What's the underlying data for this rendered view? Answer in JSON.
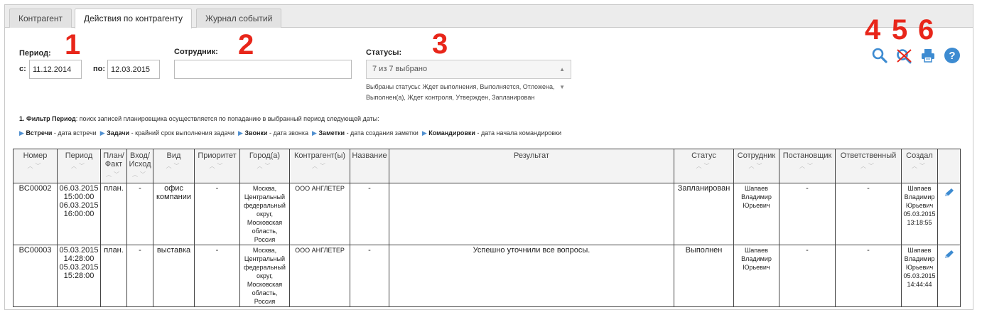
{
  "tabs": [
    {
      "label": "Контрагент"
    },
    {
      "label": "Действия по контрагенту"
    },
    {
      "label": "Журнал событий"
    }
  ],
  "filters": {
    "period_label": "Период:",
    "from_label": "с:",
    "from_value": "11.12.2014",
    "to_label": "по:",
    "to_value": "12.03.2015",
    "employee_label": "Сотрудник:",
    "employee_value": "",
    "statuses_label": "Статусы:",
    "statuses_value": "7 из 7 выбрано",
    "statuses_note_1": "Выбраны статусы: Ждет выполнения, Выполняется, Отложена,",
    "statuses_note_2": "Выполнен(а), Ждет контроля, Утвержден, Запланирован"
  },
  "markers": [
    "1",
    "2",
    "3",
    "4",
    "5",
    "6"
  ],
  "icons": {
    "search": "search-icon",
    "clear": "clear-filter-icon",
    "print": "print-icon",
    "help": "help-icon",
    "accent": "#3d8bd1",
    "marker_color": "#e8261a"
  },
  "note": {
    "intro_bold": "1. Фильтр Период",
    "intro_rest": ": поиск записей планировщика осуществляется по попаданию в выбранный период следующей даты:",
    "items": [
      {
        "bold": "Встречи",
        "rest": " - дата встречи"
      },
      {
        "bold": "Задачи",
        "rest": " - крайний срок выполнения задачи"
      },
      {
        "bold": "Звонки",
        "rest": " - дата звонка"
      },
      {
        "bold": "Заметки",
        "rest": " - дата создания заметки"
      },
      {
        "bold": "Командировки",
        "rest": " - дата начала командировки"
      }
    ]
  },
  "table": {
    "headers": [
      {
        "l1": "Номер",
        "l2": "",
        "sort": true
      },
      {
        "l1": "Период",
        "l2": "",
        "sort": true
      },
      {
        "l1": "План/",
        "l2": "Факт",
        "sort": true
      },
      {
        "l1": "Вход/",
        "l2": "Исход",
        "sort": true
      },
      {
        "l1": "Вид",
        "l2": "",
        "sort": true
      },
      {
        "l1": "Приоритет",
        "l2": "",
        "sort": true
      },
      {
        "l1": "Город(а)",
        "l2": "",
        "sort": true
      },
      {
        "l1": "Контрагент(ы)",
        "l2": "",
        "sort": true
      },
      {
        "l1": "Название",
        "l2": "",
        "sort": false
      },
      {
        "l1": "Результат",
        "l2": "",
        "sort": false
      },
      {
        "l1": "Статус",
        "l2": "",
        "sort": true
      },
      {
        "l1": "Сотрудник",
        "l2": "",
        "sort": true
      },
      {
        "l1": "Постановщик",
        "l2": "",
        "sort": true
      },
      {
        "l1": "Ответственный",
        "l2": "",
        "sort": true
      },
      {
        "l1": "Создал",
        "l2": "",
        "sort": true
      },
      {
        "l1": "",
        "l2": "",
        "sort": false
      }
    ],
    "rows": [
      {
        "number": "BC00002",
        "period": [
          "06.03.2015",
          "15:00:00",
          "06.03.2015",
          "16:00:00"
        ],
        "plan": "план.",
        "direction": "-",
        "kind": [
          "офис",
          "компании"
        ],
        "priority": "-",
        "city": [
          "Москва,",
          "Центральный",
          "федеральный",
          "округ,",
          "Московская",
          "область,",
          "Россия"
        ],
        "counterparty": "ООО АНГЛЕТЕР",
        "name": "-",
        "result": "",
        "status": "Запланирован",
        "employee": [
          "Шапаев",
          "Владимир",
          "Юрьевич"
        ],
        "setter": "-",
        "responsible": "-",
        "created": [
          "Шапаев",
          "Владимир",
          "Юрьевич",
          "05.03.2015",
          "13:18:55"
        ]
      },
      {
        "number": "BC00003",
        "period": [
          "05.03.2015",
          "14:28:00",
          "05.03.2015",
          "15:28:00"
        ],
        "plan": "план.",
        "direction": "-",
        "kind": [
          "выставка"
        ],
        "priority": "-",
        "city": [
          "Москва,",
          "Центральный",
          "федеральный",
          "округ,",
          "Московская",
          "область,",
          "Россия"
        ],
        "counterparty": "ООО АНГЛЕТЕР",
        "name": "-",
        "result": "Успешно уточнили все вопросы.",
        "status": "Выполнен",
        "employee": [
          "Шапаев",
          "Владимир",
          "Юрьевич"
        ],
        "setter": "-",
        "responsible": "-",
        "created": [
          "Шапаев",
          "Владимир",
          "Юрьевич",
          "05.03.2015",
          "14:44:44"
        ]
      }
    ]
  }
}
